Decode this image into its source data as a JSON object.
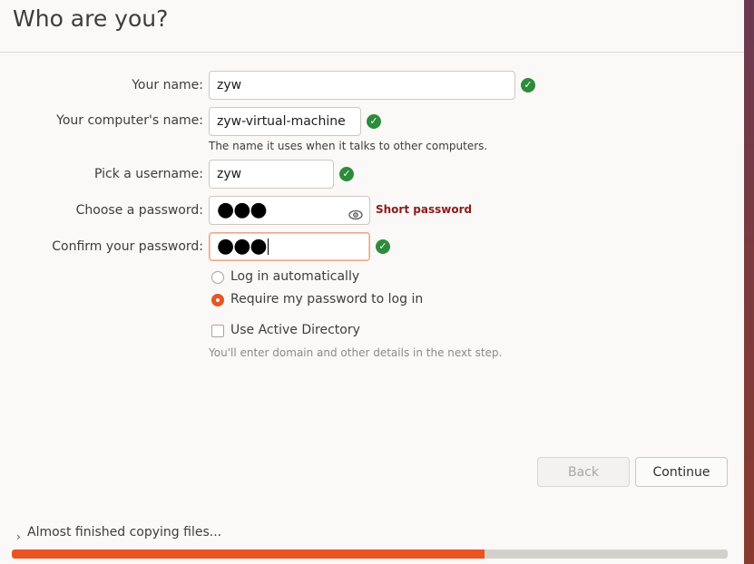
{
  "header": {
    "title": "Who are you?"
  },
  "form": {
    "name": {
      "label": "Your name:",
      "value": "zyw",
      "valid": true
    },
    "computer": {
      "label": "Your computer's name:",
      "value": "zyw-virtual-machine",
      "hint": "The name it uses when it talks to other computers.",
      "valid": true
    },
    "username": {
      "label": "Pick a username:",
      "value": "zyw",
      "valid": true
    },
    "password": {
      "label": "Choose a password:",
      "masked": "●●●",
      "strength": "Short password"
    },
    "confirm": {
      "label": "Confirm your password:",
      "masked": "●●●",
      "valid": true
    },
    "login_options": [
      {
        "label": "Log in automatically",
        "selected": false
      },
      {
        "label": "Require my password to log in",
        "selected": true
      }
    ],
    "active_directory": {
      "label": "Use Active Directory",
      "checked": false,
      "hint": "You'll enter domain and other details in the next step."
    }
  },
  "buttons": {
    "back": "Back",
    "continue": "Continue"
  },
  "progress": {
    "label": "Almost finished copying files...",
    "percent": 66
  },
  "colors": {
    "accent": "#e95420",
    "valid": "#2e8b3a",
    "warning": "#8b1a1a"
  },
  "icons": {
    "valid": "check-circle-icon",
    "reveal": "eye-icon",
    "expander": "chevron-right-icon"
  }
}
